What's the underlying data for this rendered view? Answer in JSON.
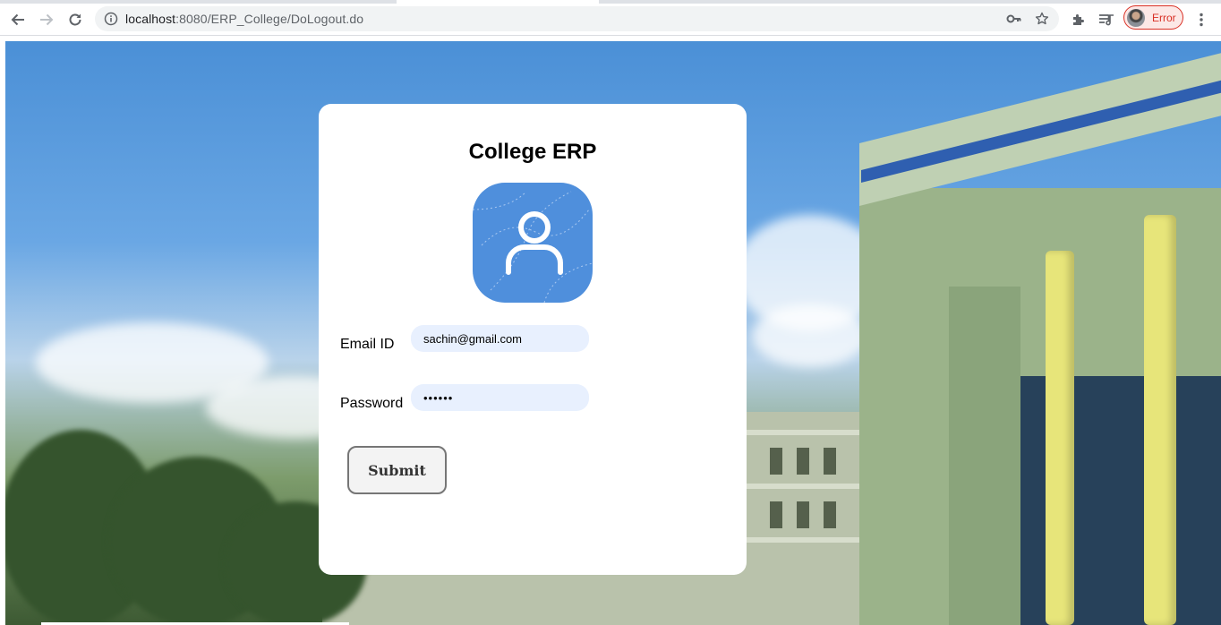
{
  "browser": {
    "url_host": "localhost",
    "url_rest": ":8080/ERP_College/DoLogout.do",
    "profile_status": "Error",
    "icons": {
      "back": "arrow-left-icon",
      "forward": "arrow-right-icon",
      "reload": "reload-icon",
      "site_info": "info-icon",
      "password_key": "key-icon",
      "bookmark": "star-icon",
      "extensions": "puzzle-icon",
      "reading_list": "queue-music-icon",
      "menu": "kebab-menu-icon"
    },
    "colors": {
      "error": "#d93025"
    }
  },
  "login": {
    "title": "College ERP",
    "email_label": "Email ID",
    "email_value": "sachin@gmail.com",
    "password_label": "Password",
    "password_value": "••••••",
    "submit_label": "Submit",
    "avatar_icon": "user-icon",
    "colors": {
      "avatar_bg": "#4f8fdc",
      "input_bg": "#e8f0fe"
    }
  }
}
